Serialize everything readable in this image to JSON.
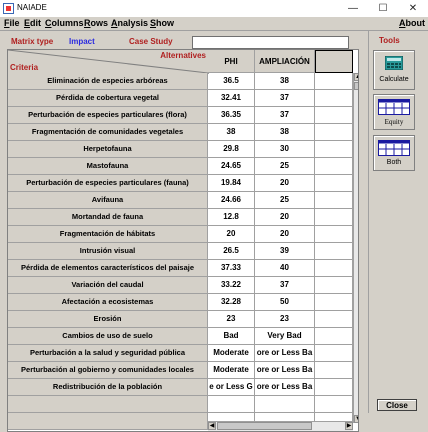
{
  "window": {
    "title": "NAIADE",
    "minimize": "—",
    "maximize": "☐",
    "close": "✕"
  },
  "menu": {
    "file": {
      "key": "F",
      "rest": "ile"
    },
    "edit": {
      "key": "E",
      "rest": "dit"
    },
    "columns": {
      "key": "C",
      "rest": "olumns"
    },
    "rows": {
      "key": "R",
      "rest": "ows"
    },
    "analysis": {
      "key": "A",
      "rest": "nalysis"
    },
    "show": {
      "key": "S",
      "rest": "how"
    },
    "about": {
      "key": "A",
      "rest": "bout"
    }
  },
  "matrix": {
    "matrix_type_label": "Matrix type",
    "matrix_type_value": "Impact",
    "case_study_label": "Case Study",
    "case_study_value": ""
  },
  "table": {
    "corner_alternatives": "Alternatives",
    "corner_criteria": "Criteria",
    "columns": [
      "PHI",
      "AMPLIACIÓN",
      ""
    ],
    "rows": [
      {
        "criterion": "Eliminación de especies arbóreas",
        "phi": "36.5",
        "ampl": "38"
      },
      {
        "criterion": "Pérdida de cobertura vegetal",
        "phi": "32.41",
        "ampl": "37"
      },
      {
        "criterion": "Perturbación de especies particulares (flora)",
        "phi": "36.35",
        "ampl": "37"
      },
      {
        "criterion": "Fragmentación de comunidades vegetales",
        "phi": "38",
        "ampl": "38"
      },
      {
        "criterion": "Herpetofauna",
        "phi": "29.8",
        "ampl": "30"
      },
      {
        "criterion": "Mastofauna",
        "phi": "24.65",
        "ampl": "25"
      },
      {
        "criterion": "Perturbación de especies particulares (fauna)",
        "phi": "19.84",
        "ampl": "20"
      },
      {
        "criterion": "Avifauna",
        "phi": "24.66",
        "ampl": "25"
      },
      {
        "criterion": "Mortandad de fauna",
        "phi": "12.8",
        "ampl": "20"
      },
      {
        "criterion": "Fragmentación de hábitats",
        "phi": "20",
        "ampl": "20"
      },
      {
        "criterion": "Intrusión visual",
        "phi": "26.5",
        "ampl": "39"
      },
      {
        "criterion": "Pérdida de elementos característicos del paisaje",
        "phi": "37.33",
        "ampl": "40"
      },
      {
        "criterion": "Variación del caudal",
        "phi": "33.22",
        "ampl": "37"
      },
      {
        "criterion": "Afectación a ecosistemas",
        "phi": "32.28",
        "ampl": "50"
      },
      {
        "criterion": "Erosión",
        "phi": "23",
        "ampl": "23"
      },
      {
        "criterion": "Cambios de uso de suelo",
        "phi": "Bad",
        "ampl": "Very Bad"
      },
      {
        "criterion": "Perturbación a la salud y seguridad pública",
        "phi": "Moderate",
        "ampl": "ore or Less Ba"
      },
      {
        "criterion": "Perturbación al gobierno y comunidades locales",
        "phi": "Moderate",
        "ampl": "ore or Less Ba"
      },
      {
        "criterion": "Redistribución de la población",
        "phi": "e or Less G",
        "ampl": "ore or Less Ba"
      },
      {
        "criterion": "",
        "phi": "",
        "ampl": ""
      },
      {
        "criterion": "",
        "phi": "",
        "ampl": ""
      }
    ]
  },
  "tools": {
    "title": "Tools",
    "calculate_label": "Calculate",
    "equity_label": "Equity",
    "both_label": "Both",
    "close_label": "Close"
  },
  "colors": {
    "label_red": "#b02020",
    "label_blue": "#2a2ae0",
    "calc_icon_teal": "#2a9a9a",
    "grid_icon_blue": "#1a1aa0"
  }
}
